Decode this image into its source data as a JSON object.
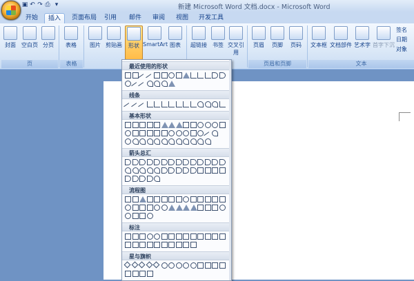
{
  "window": {
    "title": "新建 Microsoft Word 文档.docx - Microsoft Word"
  },
  "quick_access": {
    "undo": "↶",
    "redo": "↷",
    "save": "▣",
    "print": "⎙",
    "customize": "▾"
  },
  "tabs": [
    "开始",
    "插入",
    "页面布局",
    "引用",
    "邮件",
    "审阅",
    "视图",
    "开发工具"
  ],
  "ribbon": {
    "buttons": [
      "封面",
      "空白页",
      "分页",
      "表格",
      "图片",
      "剪贴画",
      "形状",
      "SmartArt",
      "图表",
      "超链接",
      "书签",
      "交叉引用",
      "页眉",
      "页脚",
      "页码",
      "文本框",
      "文档部件",
      "艺术字",
      "首字下沉"
    ],
    "side_items": [
      "签名",
      "日期",
      "对象"
    ],
    "groups": [
      "页",
      "表格",
      "页眉和页脚",
      "文本"
    ]
  },
  "shapes_panel": {
    "sections": [
      "最近使用的形状",
      "线条",
      "基本形状",
      "箭头总汇",
      "流程图",
      "标注",
      "星与旗帜"
    ]
  },
  "colors": {
    "ribbon": "#dbe8f7",
    "highlight": "#ffbc48",
    "desktop": "#6f93c4"
  }
}
